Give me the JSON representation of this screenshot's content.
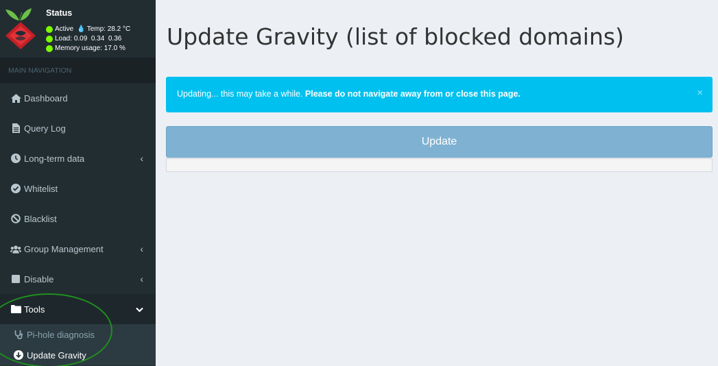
{
  "status": {
    "title": "Status",
    "active": "Active",
    "temp_label": "Temp:",
    "temp_value": "28.2 °C",
    "load_label": "Load:",
    "load_values": "0.09  0.34  0.36",
    "memory_label": "Memory usage:",
    "memory_value": "17.0 %"
  },
  "sidebar": {
    "header": "MAIN NAVIGATION",
    "items": [
      {
        "label": "Dashboard",
        "icon": "home-icon"
      },
      {
        "label": "Query Log",
        "icon": "file-icon"
      },
      {
        "label": "Long-term data",
        "icon": "clock-icon"
      },
      {
        "label": "Whitelist",
        "icon": "check-circle-icon"
      },
      {
        "label": "Blacklist",
        "icon": "ban-icon"
      },
      {
        "label": "Group Management",
        "icon": "users-icon"
      },
      {
        "label": "Disable",
        "icon": "stop-icon"
      },
      {
        "label": "Tools",
        "icon": "folder-icon"
      }
    ],
    "sub_items": [
      {
        "label": "Pi-hole diagnosis",
        "icon": "stethoscope-icon"
      },
      {
        "label": "Update Gravity",
        "icon": "arrow-down-circle-icon"
      }
    ]
  },
  "main": {
    "title": "Update Gravity (list of blocked domains)",
    "alert_text": "Updating... this may take a while.",
    "alert_bold": "Please do not navigate away from or close this page.",
    "alert_close": "×",
    "button_label": "Update"
  },
  "colors": {
    "sidebar_bg": "#222d32",
    "alert_bg": "#00c0ef",
    "button_bg": "#7fb2d2",
    "status_green": "#7cfc00",
    "annotation_oval": "#1f8f1f"
  }
}
